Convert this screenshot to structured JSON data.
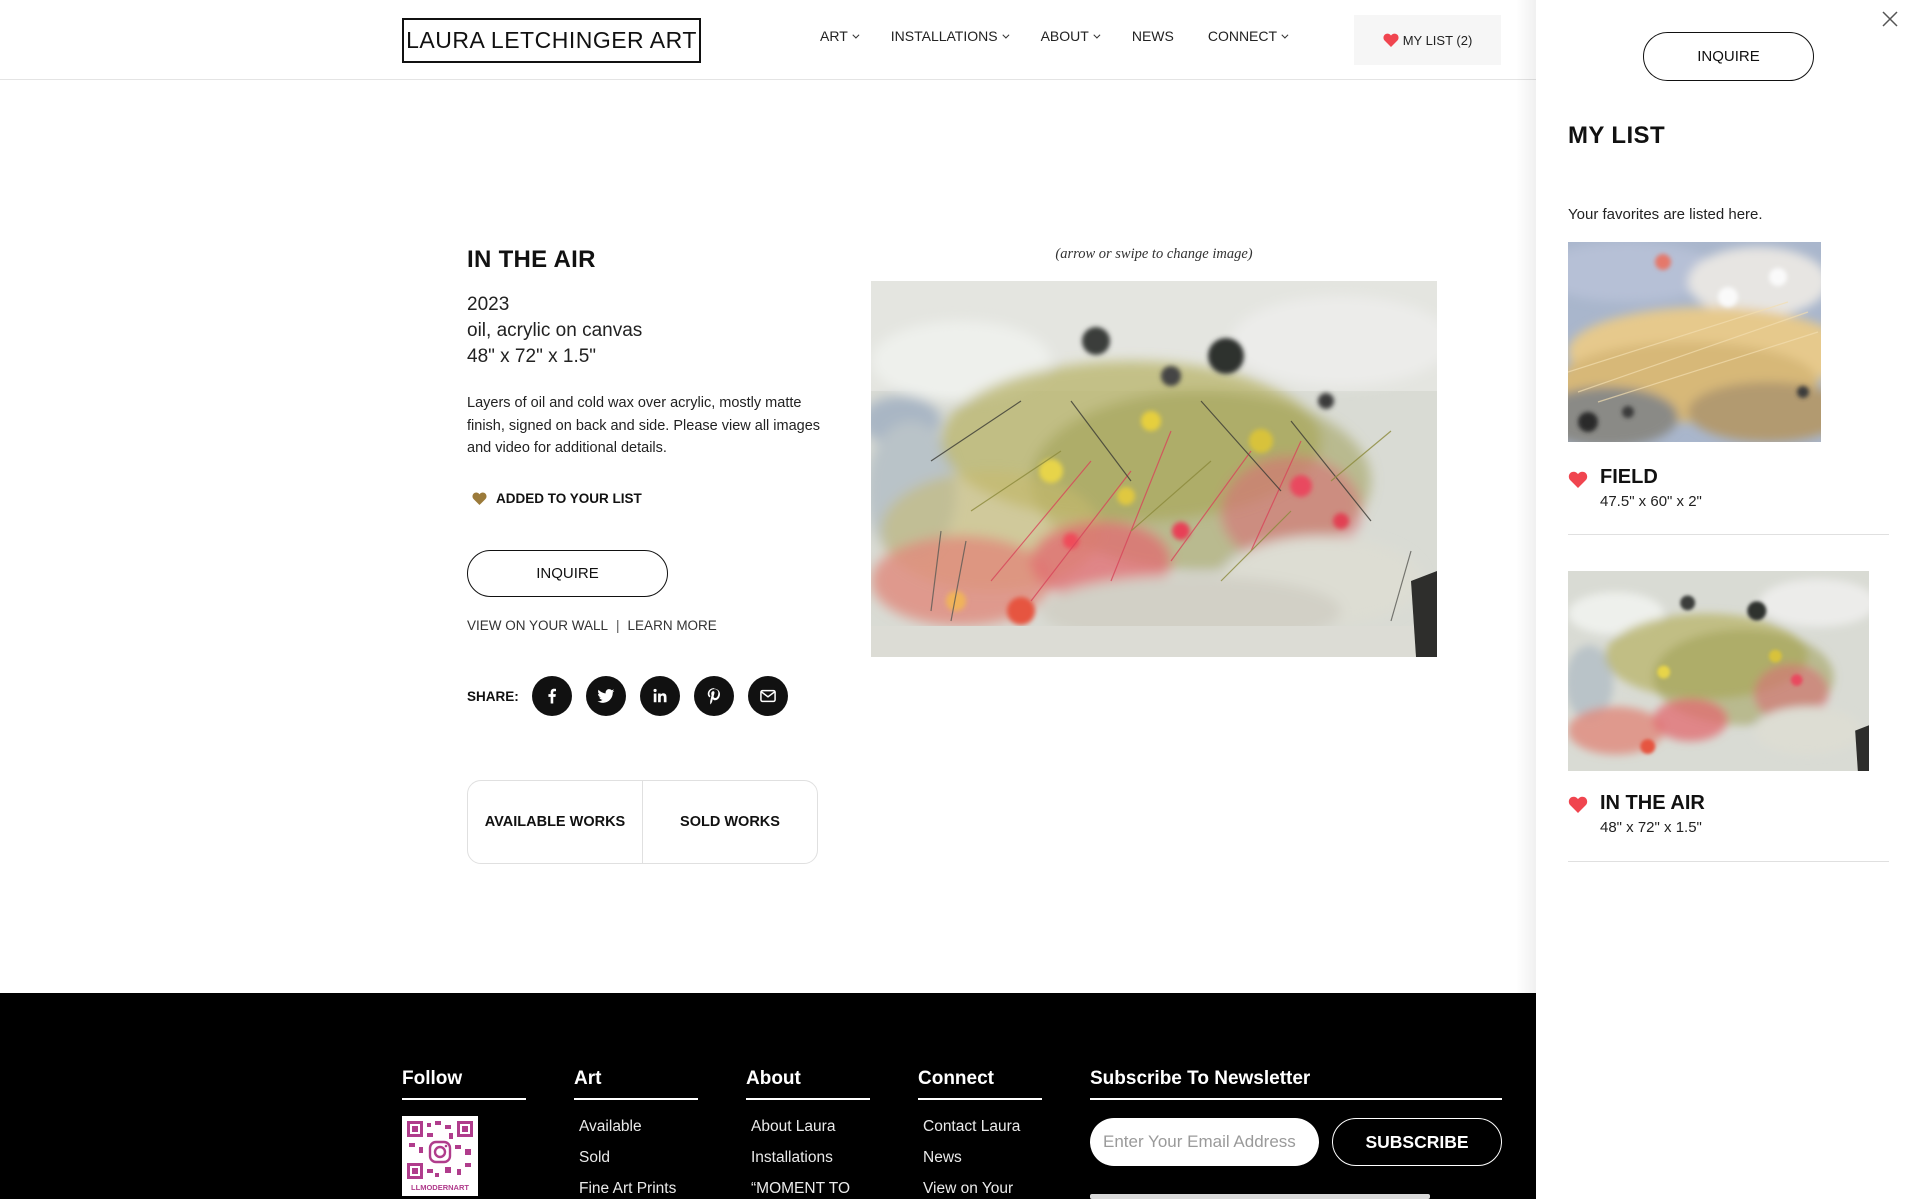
{
  "colors": {
    "accent_heart": "#f0454f",
    "added_heart": "#9b7a3a",
    "footer_bg": "#000000"
  },
  "header": {
    "logo": "LAURA LETCHINGER ART",
    "nav": [
      {
        "label": "ART",
        "has_dropdown": true
      },
      {
        "label": "INSTALLATIONS",
        "has_dropdown": true
      },
      {
        "label": "ABOUT",
        "has_dropdown": true
      },
      {
        "label": "NEWS",
        "has_dropdown": false
      },
      {
        "label": "CONNECT",
        "has_dropdown": true
      }
    ],
    "mylist_label": "MY LIST (2)",
    "mylist_icon": "heart-icon"
  },
  "artwork": {
    "title": "IN THE AIR",
    "year": "2023",
    "medium": "oil, acrylic on canvas",
    "dimensions": "48\" x 72\" x 1.5\"",
    "description": "Layers of oil and cold wax over acrylic, mostly matte finish, signed on back and side. Please view all images and video for additional details.",
    "added_label": "ADDED TO YOUR LIST",
    "inquire_label": "INQUIRE",
    "view_wall_label": "VIEW ON YOUR WALL",
    "link_separator": "|",
    "learn_more_label": "LEARN MORE",
    "share_label": "SHARE:",
    "share_icons": [
      "facebook-icon",
      "twitter-icon",
      "linkedin-icon",
      "pinterest-icon",
      "email-icon"
    ],
    "swipe_hint": "(arrow or swipe to change image)"
  },
  "works_tabs": {
    "available": "AVAILABLE WORKS",
    "sold": "SOLD WORKS"
  },
  "footer": {
    "follow": {
      "heading": "Follow",
      "qr_caption": "LLMODERNART"
    },
    "art": {
      "heading": "Art",
      "items": [
        "Available",
        "Sold",
        "Fine Art Prints"
      ]
    },
    "about": {
      "heading": "About",
      "items": [
        "About Laura",
        "Installations",
        "“MOMENT TO"
      ]
    },
    "connect": {
      "heading": "Connect",
      "items": [
        "Contact Laura",
        "News",
        "View on Your"
      ]
    },
    "newsletter": {
      "heading": "Subscribe To Newsletter",
      "email_placeholder": "Enter Your Email Address",
      "email_value": "",
      "subscribe_label": "SUBSCRIBE"
    }
  },
  "drawer": {
    "inquire_label": "INQUIRE",
    "close_icon": "close-icon",
    "title": "MY LIST",
    "subtitle": "Your favorites are listed here.",
    "items": [
      {
        "name": "FIELD",
        "dimensions": "47.5\" x 60\" x 2\""
      },
      {
        "name": "IN THE AIR",
        "dimensions": "48\" x 72\" x 1.5\""
      }
    ]
  }
}
